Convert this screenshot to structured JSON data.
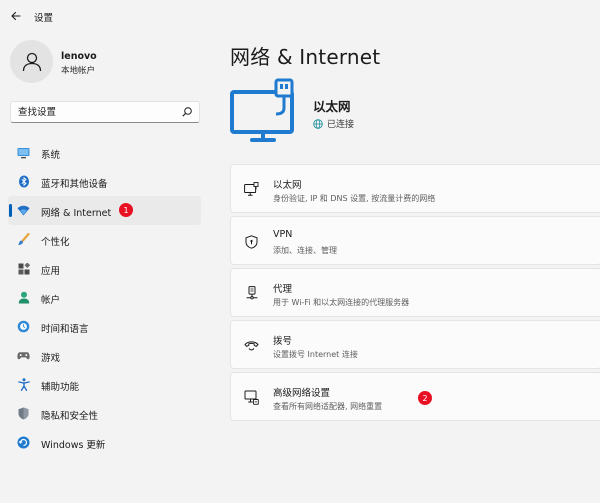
{
  "window": {
    "title": "设置"
  },
  "user": {
    "name": "lenovo",
    "account_type": "本地帐户"
  },
  "search": {
    "placeholder": "查找设置"
  },
  "sidebar": {
    "items": [
      {
        "label": "系统",
        "icon": "monitor-icon",
        "active": false
      },
      {
        "label": "蓝牙和其他设备",
        "icon": "bluetooth-icon",
        "active": false
      },
      {
        "label": "网络 & Internet",
        "icon": "wifi-icon",
        "active": true,
        "badge": "1"
      },
      {
        "label": "个性化",
        "icon": "brush-icon",
        "active": false
      },
      {
        "label": "应用",
        "icon": "apps-icon",
        "active": false
      },
      {
        "label": "帐户",
        "icon": "person-icon",
        "active": false
      },
      {
        "label": "时间和语言",
        "icon": "globe-clock-icon",
        "active": false
      },
      {
        "label": "游戏",
        "icon": "gamepad-icon",
        "active": false
      },
      {
        "label": "辅助功能",
        "icon": "accessibility-icon",
        "active": false
      },
      {
        "label": "隐私和安全性",
        "icon": "shield-icon",
        "active": false
      },
      {
        "label": "Windows 更新",
        "icon": "update-icon",
        "active": false
      }
    ]
  },
  "main": {
    "title": "网络 & Internet",
    "ethernet": {
      "name": "以太网",
      "status": "已连接"
    },
    "cards": [
      {
        "title": "以太网",
        "subtitle": "身份验证, IP 和 DNS 设置, 按流量计费的网络",
        "icon": "ethernet-icon"
      },
      {
        "title": "VPN",
        "subtitle": "添加、连接、管理",
        "icon": "vpn-shield-icon"
      },
      {
        "title": "代理",
        "subtitle": "用于 Wi-Fi 和以太网连接的代理服务器",
        "icon": "proxy-icon"
      },
      {
        "title": "拨号",
        "subtitle": "设置拨号 Internet 连接",
        "icon": "dialup-icon"
      },
      {
        "title": "高级网络设置",
        "subtitle": "查看所有网络适配器, 网络重置",
        "icon": "advanced-network-icon",
        "badge": "2"
      }
    ]
  },
  "colors": {
    "accent": "#005fb8",
    "badge": "#e81123",
    "background": "#f3f3f3",
    "card": "#fbfbfb"
  }
}
